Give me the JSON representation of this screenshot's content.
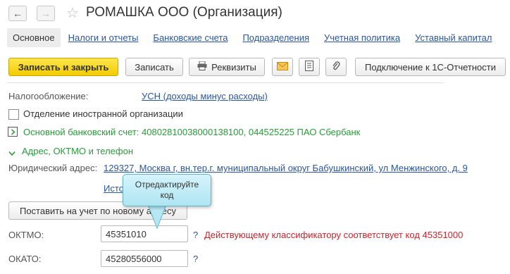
{
  "window": {
    "title": "РОМАШКА ООО (Организация)",
    "back_icon": "arrow-left-icon",
    "forward_icon": "arrow-right-icon",
    "favorite_icon": "star-icon"
  },
  "tabs": [
    {
      "label": "Основное",
      "active": true
    },
    {
      "label": "Налоги и отчеты"
    },
    {
      "label": "Банковские счета"
    },
    {
      "label": "Подразделения"
    },
    {
      "label": "Учетная политика"
    },
    {
      "label": "Уставный капитал"
    }
  ],
  "toolbar": {
    "save_close_label": "Записать и закрыть",
    "save_label": "Записать",
    "requisites_label": "Реквизиты",
    "connect_label": "Подключение к 1С-Отчетности",
    "icons": [
      "printer-icon",
      "envelope-icon",
      "document-icon",
      "paperclip-icon"
    ]
  },
  "form": {
    "tax_label": "Налогообложение:",
    "tax_value": "УСН (доходы минус расходы)",
    "foreign_checkbox_label": "Отделение иностранной организации",
    "bank_account_text": "Основной банковский счет: 40802810038000138100, 044525225 ПАО Сбербанк",
    "address_section_label": "Адрес, ОКТМО и телефон",
    "legal_address_label": "Юридический адрес:",
    "legal_address_value": "129327, Москва г, вн.тер.г. муниципальный округ Бабушкинский, ул Менжинского, д. 9",
    "history_link_partial": "Исто",
    "register_button_label": "Поставить на учет по новому адресу",
    "oktmo_label": "ОКТМО:",
    "oktmo_value": "45351010",
    "oktmo_qmark": "?",
    "oktmo_warning": "Действующему классификатору соответствует код 45351000",
    "okato_label": "ОКАТО:",
    "okato_value": "45280556000",
    "okato_qmark": "?"
  },
  "tooltip": {
    "line1": "Отредактируйте",
    "line2": "код"
  },
  "colors": {
    "link": "#2a56a0",
    "section_green": "#2a9a3a",
    "warning_red": "#c8242b",
    "primary_button": "#f2cb00",
    "tooltip_bg": "#c4eef8"
  }
}
